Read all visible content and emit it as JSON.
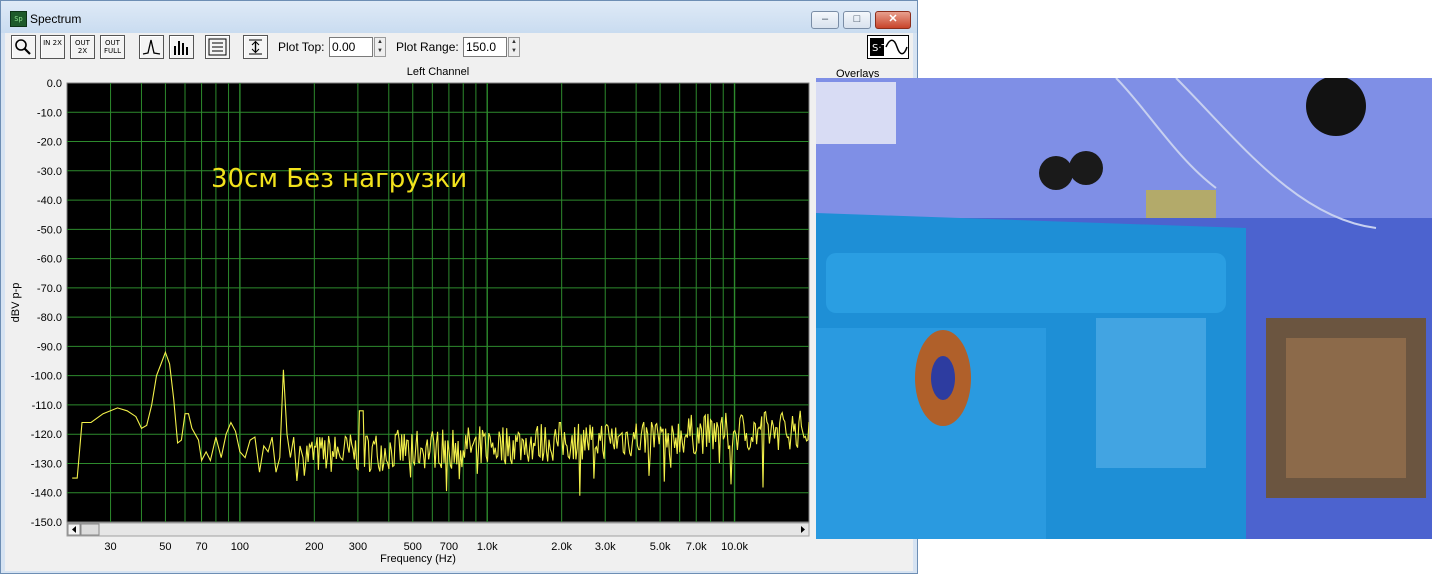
{
  "window": {
    "title": "Spectrum",
    "app_icon_text": "Sp",
    "controls": {
      "minimize": "–",
      "maximize": "□",
      "close": "✕"
    }
  },
  "toolbar": {
    "zoom_icon": "magnifier-icon",
    "zoom_in_label": "IN 2X",
    "zoom_out_label": "OUT 2X",
    "zoom_full_label": "OUT FULL",
    "line_mode_icon": "line-spectrum-icon",
    "bar_mode_icon": "bar-spectrum-icon",
    "settings_icon": "settings-icon",
    "scale_icon": "vertical-scale-icon",
    "plot_top_label": "Plot Top:",
    "plot_top_value": "0.00",
    "plot_range_label": "Plot Range:",
    "plot_range_value": "150.0",
    "signal_icon": "signal-generator-icon",
    "signal_icon_text": "S·T"
  },
  "overlays_label": "Overlays",
  "chart_data": {
    "type": "line",
    "title": "Left Channel",
    "xlabel": "Frequency (Hz)",
    "ylabel": "dBV p-p",
    "xscale": "log",
    "xlim": [
      20,
      20000
    ],
    "ylim": [
      -150,
      0
    ],
    "grid": true,
    "background": "#000000",
    "grid_color": "#2d8a2d",
    "trace_color": "#f2f04a",
    "annotation_color": "#f2e21c",
    "annotation": "30см Без нагрузки",
    "y_ticks": [
      "0.0",
      "-10.0",
      "-20.0",
      "-30.0",
      "-40.0",
      "-50.0",
      "-60.0",
      "-70.0",
      "-80.0",
      "-90.0",
      "-100.0",
      "-110.0",
      "-120.0",
      "-130.0",
      "-140.0",
      "-150.0"
    ],
    "x_tick_labels": [
      {
        "v": 30,
        "t": "30"
      },
      {
        "v": 50,
        "t": "50"
      },
      {
        "v": 70,
        "t": "70"
      },
      {
        "v": 100,
        "t": "100"
      },
      {
        "v": 200,
        "t": "200"
      },
      {
        "v": 300,
        "t": "300"
      },
      {
        "v": 500,
        "t": "500"
      },
      {
        "v": 700,
        "t": "700"
      },
      {
        "v": 1000,
        "t": "1.0k"
      },
      {
        "v": 2000,
        "t": "2.0k"
      },
      {
        "v": 3000,
        "t": "3.0k"
      },
      {
        "v": 5000,
        "t": "5.0k"
      },
      {
        "v": 7000,
        "t": "7.0k"
      },
      {
        "v": 10000,
        "t": "10.0k"
      }
    ],
    "series": [
      {
        "x": [
          21,
          22,
          23,
          25,
          28,
          32,
          35,
          38,
          40,
          42,
          44,
          46,
          48,
          50,
          52,
          54,
          56,
          58,
          60,
          62,
          64,
          66,
          68,
          70,
          73,
          76,
          80,
          84,
          88,
          92,
          96,
          100,
          105,
          110,
          115,
          120,
          125,
          130,
          135,
          140,
          145,
          150,
          155,
          160,
          165,
          170,
          175,
          180
        ],
        "y": [
          -135,
          -135,
          -116,
          -116,
          -113,
          -111,
          -112,
          -114,
          -118,
          -117,
          -110,
          -100,
          -96,
          -92,
          -96,
          -108,
          -123,
          -122,
          -113,
          -113,
          -118,
          -120,
          -122,
          -129,
          -126,
          -129,
          -121,
          -128,
          -120,
          -116,
          -119,
          -126,
          -128,
          -122,
          -121,
          -133,
          -124,
          -126,
          -121,
          -133,
          -128,
          -98,
          -120,
          -128,
          -121,
          -136,
          -124,
          -128
        ]
      }
    ]
  }
}
